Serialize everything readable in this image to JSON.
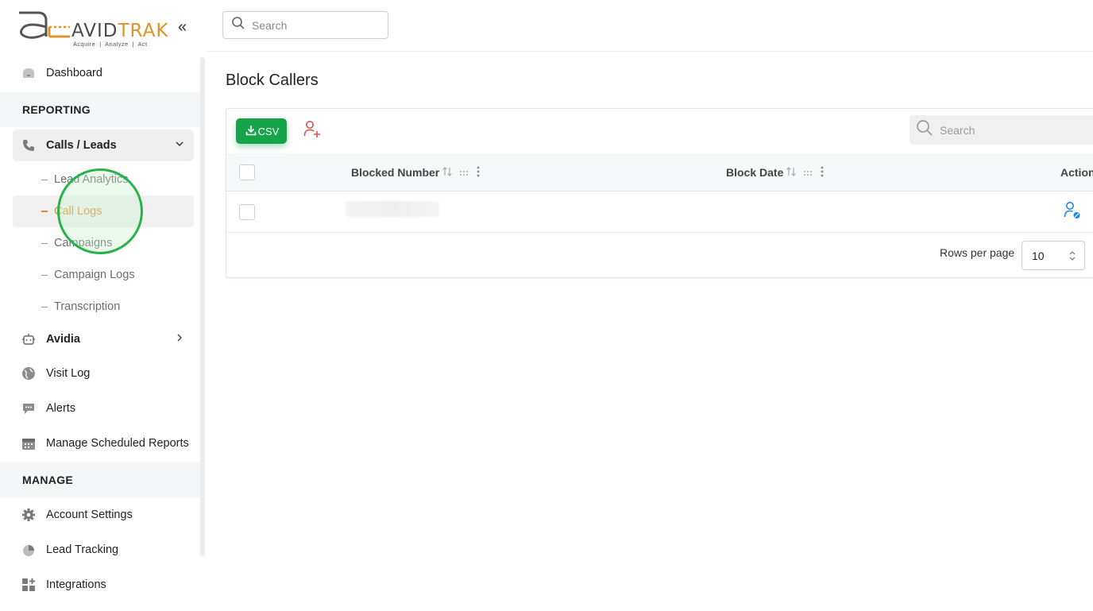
{
  "brand": {
    "name_part1": "AVID",
    "name_part2": "TRAK",
    "tagline": "Acquire  |  Analyze  |  Act",
    "accent_color": "#e0932b"
  },
  "sidebar": {
    "collapse_icon": "double-chevron-left-icon",
    "items_top": [
      {
        "label": "Dashboard",
        "icon": "dashboard-icon"
      }
    ],
    "sections": [
      {
        "title": "REPORTING"
      },
      {
        "title": "MANAGE"
      }
    ],
    "calls_leads": {
      "label": "Calls / Leads",
      "icon": "phone-icon",
      "expanded": true,
      "children": [
        {
          "label": "Lead Analytics",
          "active": false
        },
        {
          "label": "Call Logs",
          "active": true
        },
        {
          "label": "Campaigns",
          "active": false
        },
        {
          "label": "Campaign Logs",
          "active": false
        },
        {
          "label": "Transcription",
          "active": false
        }
      ]
    },
    "reporting_items": [
      {
        "label": "Avidia",
        "icon": "robot-icon"
      },
      {
        "label": "Visit Log",
        "icon": "globe-icon"
      },
      {
        "label": "Alerts",
        "icon": "chat-alert-icon"
      },
      {
        "label": "Manage Scheduled Reports",
        "icon": "calendar-icon"
      }
    ],
    "manage_items": [
      {
        "label": "Account Settings",
        "icon": "gear-icon"
      },
      {
        "label": "Lead Tracking",
        "icon": "pie-chart-icon"
      },
      {
        "label": "Integrations",
        "icon": "integrations-icon"
      }
    ]
  },
  "topbar": {
    "search_placeholder": "Search"
  },
  "page": {
    "title": "Block Callers"
  },
  "table": {
    "csv_label": "CSV",
    "search_placeholder": "Search",
    "columns": [
      "Blocked Number",
      "Block Date",
      "Action"
    ],
    "rows_per_page_label": "Rows per page",
    "rows_per_page_value": "10",
    "primary_color": "#16a34a",
    "danger_color": "#d9534f",
    "info_color": "#1e88e5"
  }
}
